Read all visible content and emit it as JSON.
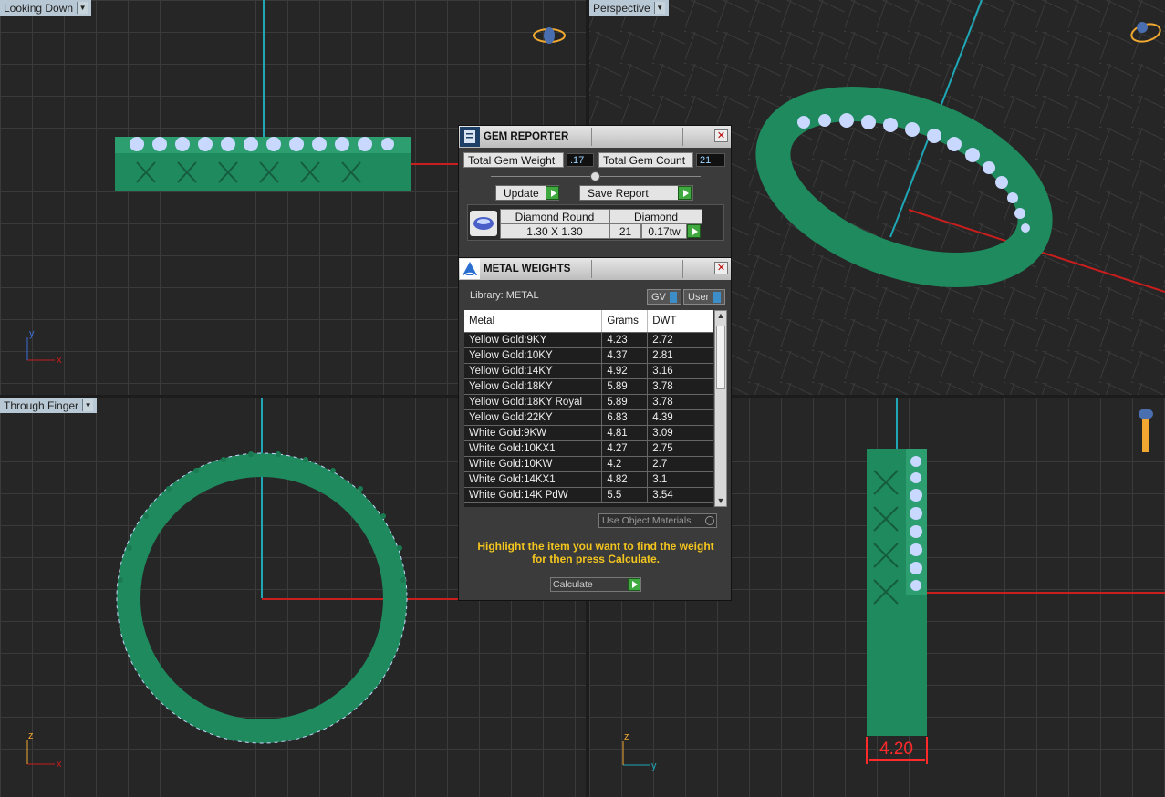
{
  "viewports": {
    "top_left": {
      "label": "Looking Down",
      "axes": {
        "v": "y",
        "h": "x"
      }
    },
    "top_right": {
      "label": "Perspective"
    },
    "bottom_left": {
      "label": "Through Finger",
      "axes": {
        "v": "z",
        "h": "x"
      }
    },
    "bottom_right": {
      "label": "",
      "axes": {
        "v": "z",
        "h": "y"
      },
      "dimension": "4.20"
    }
  },
  "gem_reporter": {
    "title": "GEM REPORTER",
    "total_gem_weight_label": "Total Gem Weight",
    "total_gem_weight_value": ".17",
    "total_gem_count_label": "Total Gem Count",
    "total_gem_count_value": "21",
    "update_label": "Update",
    "save_report_label": "Save Report",
    "gem": {
      "shape": "Diamond Round",
      "size": "1.30 X 1.30",
      "material": "Diamond",
      "count": "21",
      "weight": "0.17tw"
    }
  },
  "metal_weights": {
    "title": "METAL WEIGHTS",
    "library_label": "Library: METAL",
    "gv_label": "GV",
    "user_label": "User",
    "columns": [
      "Metal",
      "Grams",
      "DWT"
    ],
    "rows": [
      [
        "Yellow Gold:9KY",
        "4.23",
        "2.72"
      ],
      [
        "Yellow Gold:10KY",
        "4.37",
        "2.81"
      ],
      [
        "Yellow Gold:14KY",
        "4.92",
        "3.16"
      ],
      [
        "Yellow Gold:18KY",
        "5.89",
        "3.78"
      ],
      [
        "Yellow Gold:18KY Royal",
        "5.89",
        "3.78"
      ],
      [
        "Yellow Gold:22KY",
        "6.83",
        "4.39"
      ],
      [
        "White Gold:9KW",
        "4.81",
        "3.09"
      ],
      [
        "White Gold:10KX1",
        "4.27",
        "2.75"
      ],
      [
        "White Gold:10KW",
        "4.2",
        "2.7"
      ],
      [
        "White Gold:14KX1",
        "4.82",
        "3.1"
      ],
      [
        "White Gold:14K PdW",
        "5.5",
        "3.54"
      ]
    ],
    "use_object_materials_label": "Use Object Materials",
    "hint_line1": "Highlight the item you want to find the weight",
    "hint_line2": "for then press Calculate.",
    "calculate_label": "Calculate"
  },
  "colors": {
    "ring": "#1f8a5e",
    "gem": "#c8d8ff",
    "axis_red": "#c81e1e",
    "axis_cyan": "#1fa7b8",
    "accent_green": "#3fa83f"
  }
}
